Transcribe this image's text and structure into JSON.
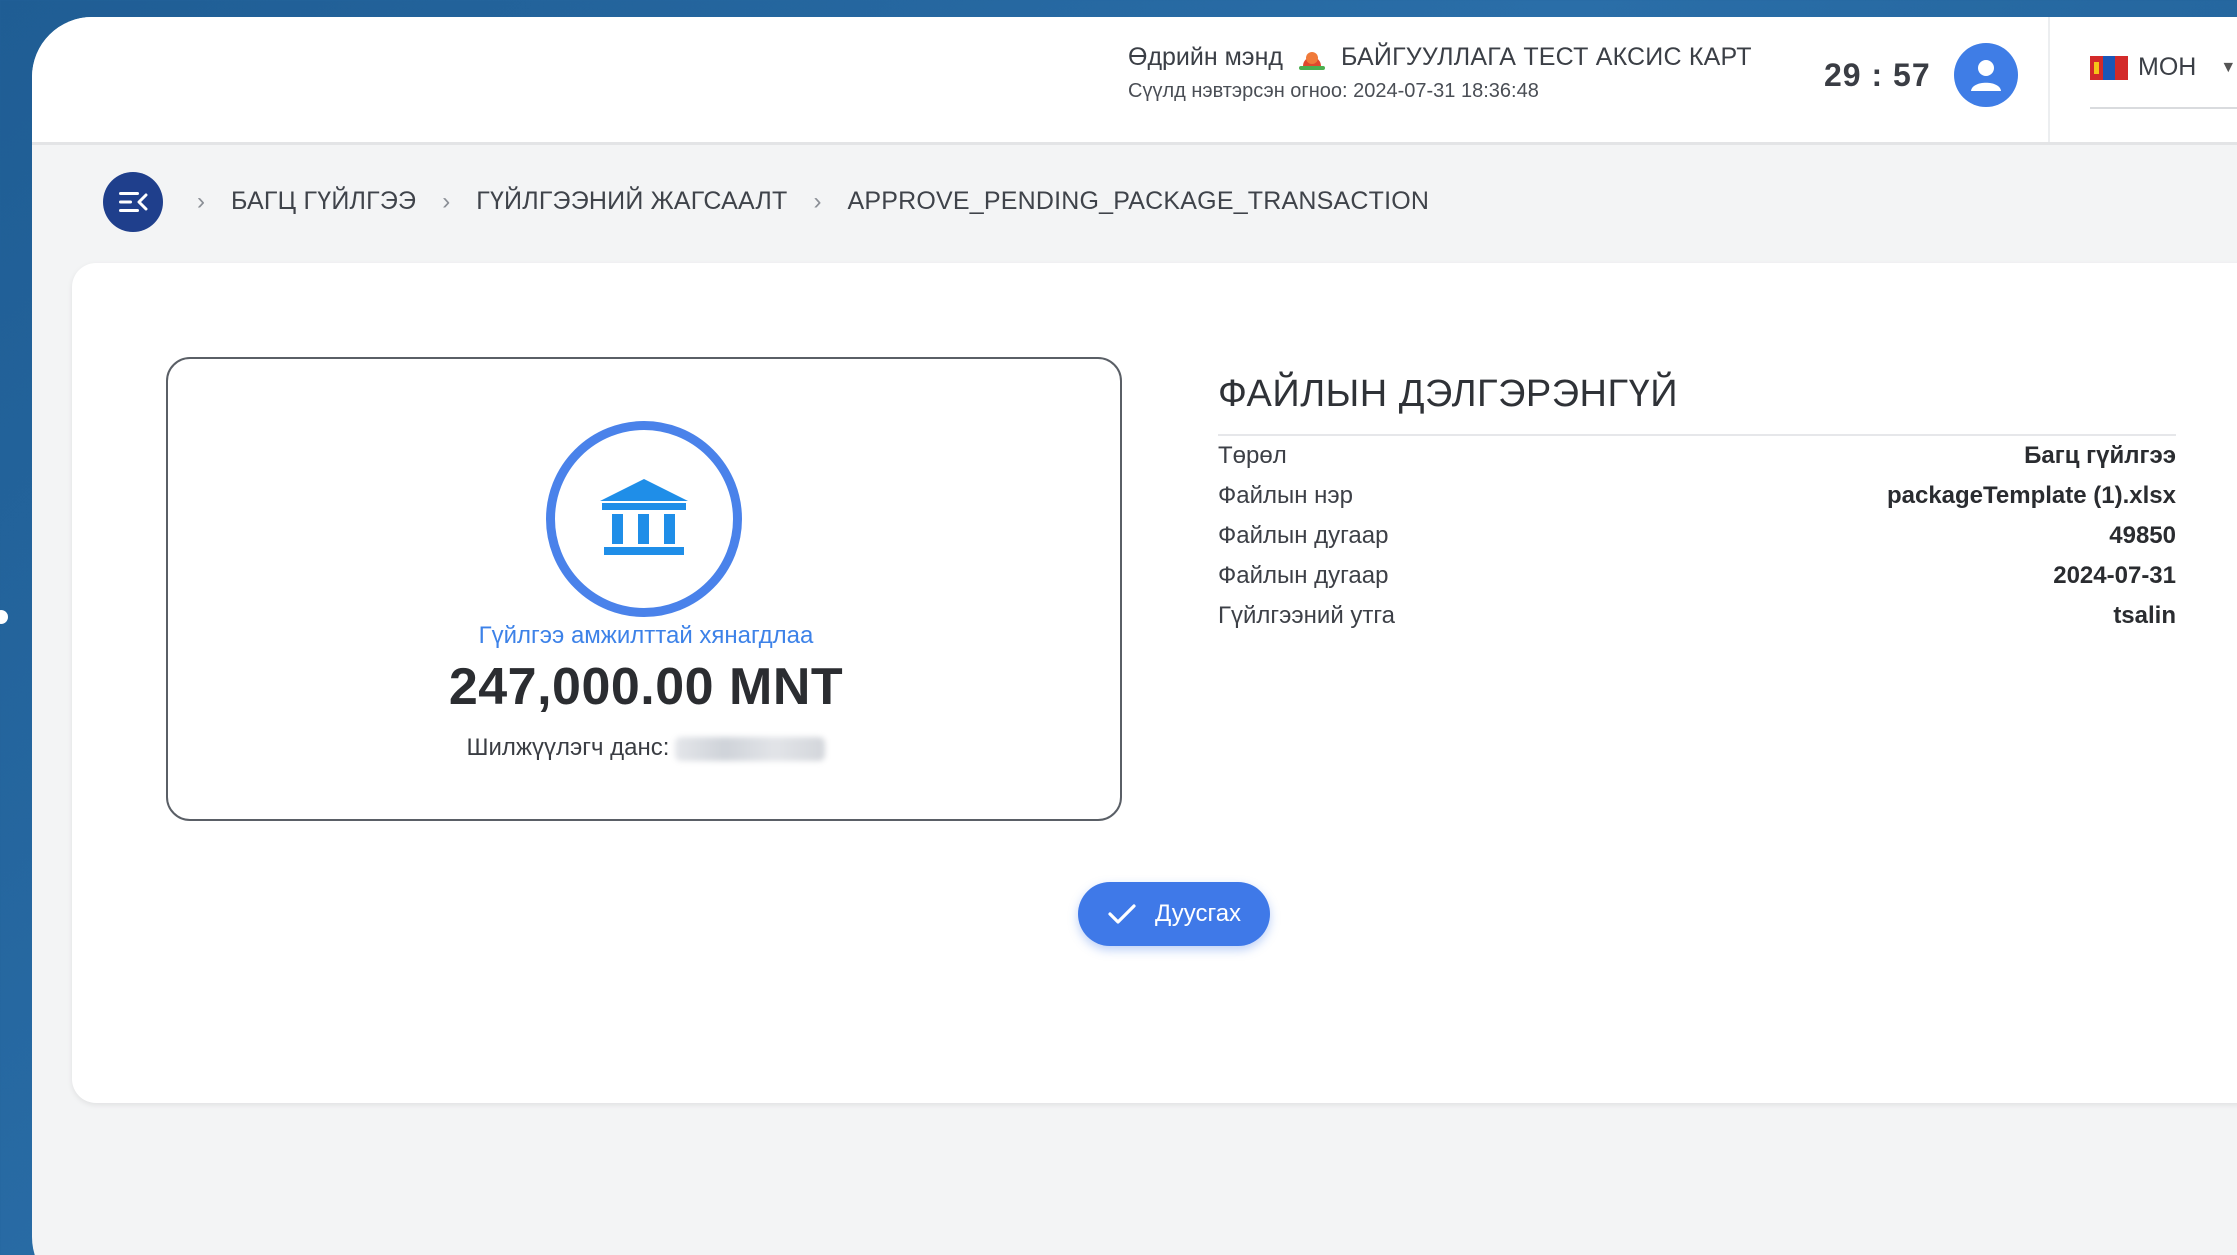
{
  "header": {
    "greeting": "Өдрийн мэнд",
    "organization": "БАЙГУУЛЛАГА ТЕСТ АКСИС КАРТ",
    "last_login": "Сүүлд нэвтэрсэн огноо: 2024-07-31 18:36:48",
    "session_timer": "29 : 57",
    "language": "МОН"
  },
  "breadcrumb": {
    "items": [
      "БАГЦ ГҮЙЛГЭЭ",
      "ГҮЙЛГЭЭНИЙ ЖАГСААЛТ",
      "APPROVE_PENDING_PACKAGE_TRANSACTION"
    ]
  },
  "result": {
    "status_text": "Гүйлгээ амжилттай хянагдлаа",
    "amount": "247,000.00 MNT",
    "sender_label": "Шилжүүлэгч данс:"
  },
  "details": {
    "title": "ФАЙЛЫН ДЭЛГЭРЭНГҮЙ",
    "rows": [
      {
        "label": "Төрөл",
        "value": "Багц гүйлгээ"
      },
      {
        "label": "Файлын нэр",
        "value": "packageTemplate (1).xlsx"
      },
      {
        "label": "Файлын дугаар",
        "value": "49850"
      },
      {
        "label": "Файлын дугаар",
        "value": "2024-07-31"
      },
      {
        "label": "Гүйлгээний утга",
        "value": "tsalin"
      }
    ]
  },
  "actions": {
    "finish_label": "Дуусгах"
  },
  "colors": {
    "accent": "#3f79e8",
    "success_text": "#3d82e8",
    "menu_button": "#1f3f8c"
  }
}
